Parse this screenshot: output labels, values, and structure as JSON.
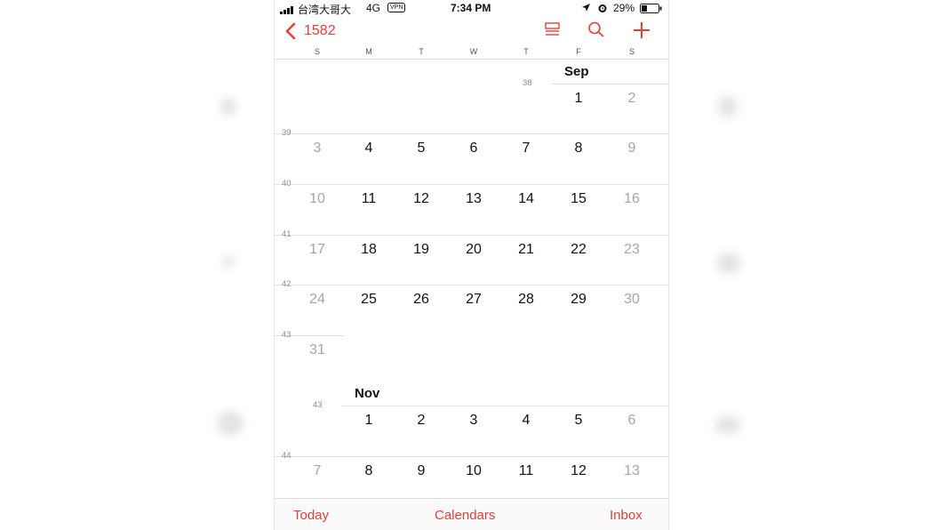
{
  "status_bar": {
    "carrier": "台湾大哥大",
    "network": "4G",
    "vpn": "VPN",
    "time": "7:34 PM",
    "battery": "29%"
  },
  "nav": {
    "back_label": "1582",
    "icons": [
      "list-view-icon",
      "search-icon",
      "add-icon"
    ]
  },
  "weekday_headers": [
    "S",
    "M",
    "T",
    "W",
    "T",
    "F",
    "S"
  ],
  "months": [
    {
      "name": "Sep",
      "weeks": [
        {
          "week": "38",
          "days": [
            "",
            "",
            "",
            "",
            "",
            "1",
            "2"
          ]
        },
        {
          "week": "39",
          "days": [
            "3",
            "4",
            "5",
            "6",
            "7",
            "8",
            "9"
          ]
        },
        {
          "week": "40",
          "days": [
            "10",
            "11",
            "12",
            "13",
            "14",
            "15",
            "16"
          ]
        },
        {
          "week": "41",
          "days": [
            "17",
            "18",
            "19",
            "20",
            "21",
            "22",
            "23"
          ]
        },
        {
          "week": "42",
          "days": [
            "24",
            "25",
            "26",
            "27",
            "28",
            "29",
            "30"
          ]
        },
        {
          "week": "43",
          "days": [
            "31",
            "",
            "",
            "",
            "",
            "",
            ""
          ]
        }
      ]
    },
    {
      "name": "Nov",
      "weeks": [
        {
          "week": "43",
          "days": [
            "",
            "1",
            "2",
            "3",
            "4",
            "5",
            "6"
          ]
        },
        {
          "week": "44",
          "days": [
            "7",
            "8",
            "9",
            "10",
            "11",
            "12",
            "13"
          ]
        }
      ]
    }
  ],
  "tab_bar": {
    "today": "Today",
    "calendars": "Calendars",
    "inbox": "Inbox"
  },
  "colors": {
    "accent": "#e0413a",
    "weekend_text": "#a6a6a6",
    "separator": "#e3e3e3"
  }
}
